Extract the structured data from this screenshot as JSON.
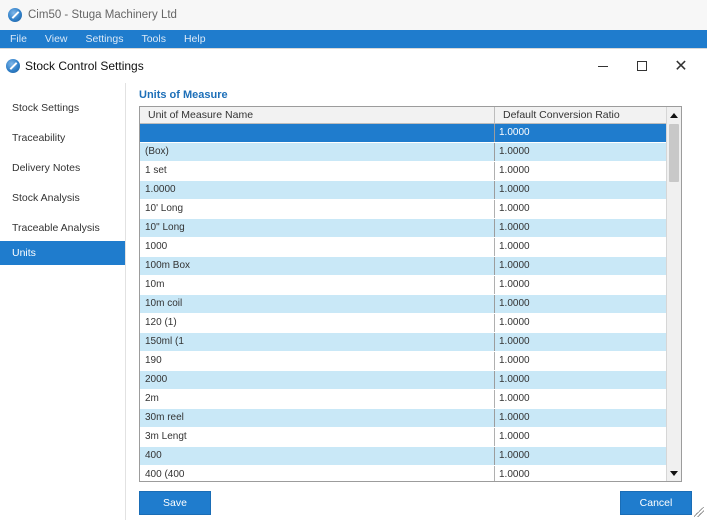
{
  "app": {
    "title": "Cim50 - Stuga Machinery Ltd",
    "menu": [
      "File",
      "View",
      "Settings",
      "Tools",
      "Help"
    ]
  },
  "dialog": {
    "title": "Stock Control Settings",
    "controls": {
      "minimize": "minimize-icon",
      "maximize": "maximize-icon",
      "close": "✕"
    }
  },
  "sidebar": {
    "items": [
      {
        "label": "Stock Settings",
        "active": false
      },
      {
        "label": "Traceability",
        "active": false
      },
      {
        "label": "Delivery Notes",
        "active": false
      },
      {
        "label": "Stock Analysis",
        "active": false
      },
      {
        "label": "Traceable Analysis",
        "active": false
      },
      {
        "label": "Units",
        "active": true
      }
    ]
  },
  "units": {
    "section_title": "Units of Measure",
    "columns": [
      "Unit of Measure Name",
      "Default Conversion Ratio"
    ],
    "selected_row": 0,
    "rows": [
      [
        "",
        "1.0000"
      ],
      [
        "(Box)",
        "1.0000"
      ],
      [
        "1 set",
        "1.0000"
      ],
      [
        "1.0000",
        "1.0000"
      ],
      [
        "10' Long",
        "1.0000"
      ],
      [
        "10\" Long",
        "1.0000"
      ],
      [
        "1000",
        "1.0000"
      ],
      [
        "100m Box",
        "1.0000"
      ],
      [
        "10m",
        "1.0000"
      ],
      [
        "10m coil",
        "1.0000"
      ],
      [
        "120 (1)",
        "1.0000"
      ],
      [
        "150ml (1",
        "1.0000"
      ],
      [
        "190",
        "1.0000"
      ],
      [
        "2000",
        "1.0000"
      ],
      [
        "2m",
        "1.0000"
      ],
      [
        "30m reel",
        "1.0000"
      ],
      [
        "3m Lengt",
        "1.0000"
      ],
      [
        "400",
        "1.0000"
      ],
      [
        "400 (400",
        "1.0000"
      ]
    ]
  },
  "buttons": {
    "save": "Save",
    "cancel": "Cancel"
  },
  "colors": {
    "accent": "#1f7ccd",
    "row_alt": "#c9e8f7",
    "section_title": "#1d6fb8"
  }
}
